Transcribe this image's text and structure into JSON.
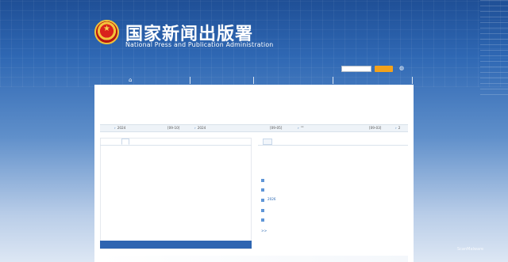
{
  "header": {
    "title_cn": "国家新闻出版署",
    "title_en": "National  Press and Publication Administration",
    "search_placeholder": "",
    "search_button": "",
    "nav_items": [
      "",
      "",
      "",
      ""
    ]
  },
  "main": {
    "headline": "",
    "subline": "",
    "ticker": [
      {
        "title": "2024",
        "date": "[09-10]"
      },
      {
        "title": "2024",
        "date": "[09-05]"
      },
      {
        "title": "\"\"",
        "date": "[09-03]"
      },
      {
        "title": "2",
        "date": ""
      }
    ],
    "left_tabs": [
      "",
      ""
    ],
    "left_footer": "",
    "right_tabs": [
      "",
      "",
      ""
    ],
    "right_title": "",
    "right_desc": "",
    "right_items": [
      "",
      "",
      "2026",
      "",
      ""
    ],
    "more_link": " >>"
  },
  "misc": {
    "watermark": "ScanMalware"
  },
  "colors": {
    "accent": "#2e65b1",
    "link": "#1d5fab",
    "search_button": "#f3a21c"
  }
}
